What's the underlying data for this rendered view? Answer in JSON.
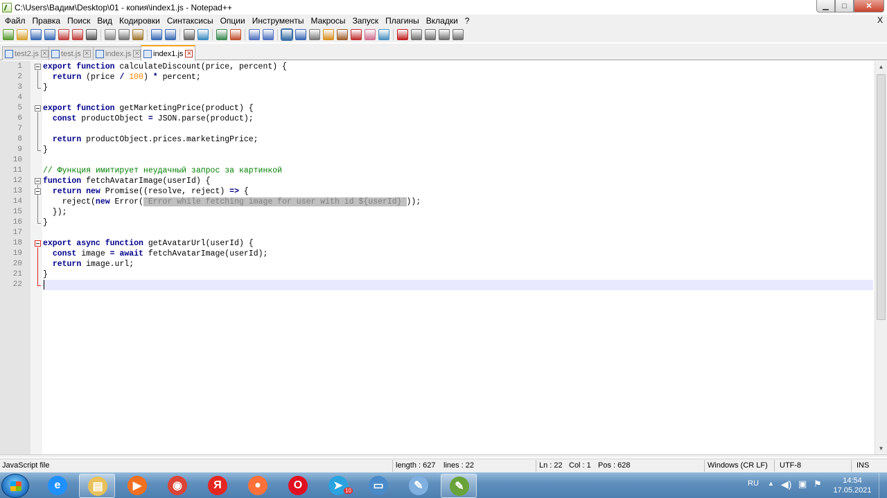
{
  "window": {
    "title": "C:\\Users\\Вадим\\Desktop\\01 - копия\\index1.js - Notepad++",
    "controls": {
      "minimize": "▁",
      "maximize": "□",
      "close": "✕"
    }
  },
  "menu": {
    "items": [
      "Файл",
      "Правка",
      "Поиск",
      "Вид",
      "Кодировки",
      "Синтаксисы",
      "Опции",
      "Инструменты",
      "Макросы",
      "Запуск",
      "Плагины",
      "Вкладки",
      "?"
    ],
    "close_label": "X"
  },
  "toolbar": {
    "icons": [
      "new-file-icon",
      "open-file-icon",
      "save-icon",
      "save-all-icon",
      "close-icon",
      "close-all-icon",
      "print-icon",
      "cut-icon",
      "copy-icon",
      "paste-icon",
      "undo-icon",
      "redo-icon",
      "find-icon",
      "replace-icon",
      "zoom-in-icon",
      "zoom-out-icon",
      "sync-vertical-icon",
      "sync-horizontal-icon",
      "word-wrap-icon",
      "all-chars-icon",
      "indent-guide-icon",
      "udl-icon",
      "doc-map-icon",
      "function-list-icon",
      "folder-workspace-icon",
      "monitoring-icon",
      "record-macro-icon",
      "stop-macro-icon",
      "play-macro-icon",
      "run-macro-multiple-icon",
      "save-macro-icon"
    ],
    "colors": {
      "accent": "#3a6ea5"
    }
  },
  "tabs": [
    {
      "label": "test2.js",
      "active": false
    },
    {
      "label": "test.js",
      "active": false
    },
    {
      "label": "index.js",
      "active": false
    },
    {
      "label": "index1.js",
      "active": true
    }
  ],
  "editor": {
    "line_numbers": [
      "1",
      "2",
      "3",
      "4",
      "5",
      "6",
      "7",
      "8",
      "9",
      "10",
      "11",
      "12",
      "13",
      "14",
      "15",
      "16",
      "17",
      "18",
      "19",
      "20",
      "21",
      "22"
    ],
    "lines": [
      [
        {
          "t": "export function ",
          "c": "kw"
        },
        {
          "t": "calculateDiscount(price, percent) {",
          "c": "fn"
        }
      ],
      [
        {
          "t": "  ",
          "c": "fn"
        },
        {
          "t": "return",
          "c": "kw"
        },
        {
          "t": " (price ",
          "c": "fn"
        },
        {
          "t": "/",
          "c": "op"
        },
        {
          "t": " ",
          "c": "fn"
        },
        {
          "t": "100",
          "c": "num"
        },
        {
          "t": ") ",
          "c": "fn"
        },
        {
          "t": "*",
          "c": "op"
        },
        {
          "t": " percent;",
          "c": "fn"
        }
      ],
      [
        {
          "t": "}",
          "c": "fn"
        }
      ],
      [],
      [
        {
          "t": "export function ",
          "c": "kw"
        },
        {
          "t": "getMarketingPrice(product) {",
          "c": "fn"
        }
      ],
      [
        {
          "t": "  ",
          "c": "fn"
        },
        {
          "t": "const",
          "c": "kw"
        },
        {
          "t": " productObject ",
          "c": "fn"
        },
        {
          "t": "=",
          "c": "op"
        },
        {
          "t": " JSON.parse(product);",
          "c": "fn"
        }
      ],
      [],
      [
        {
          "t": "  ",
          "c": "fn"
        },
        {
          "t": "return",
          "c": "kw"
        },
        {
          "t": " productObject.prices.marketingPrice;",
          "c": "fn"
        }
      ],
      [
        {
          "t": "}",
          "c": "fn"
        }
      ],
      [],
      [
        {
          "t": "// Функция имитирует неудачный запрос за картинкой",
          "c": "cm"
        }
      ],
      [
        {
          "t": "function ",
          "c": "kw"
        },
        {
          "t": "fetchAvatarImage(userId) {",
          "c": "fn"
        }
      ],
      [
        {
          "t": "  ",
          "c": "fn"
        },
        {
          "t": "return new",
          "c": "kw"
        },
        {
          "t": " Promise((resolve, reject) ",
          "c": "fn"
        },
        {
          "t": "=>",
          "c": "op"
        },
        {
          "t": " {",
          "c": "fn"
        }
      ],
      [
        {
          "t": "    reject(",
          "c": "fn"
        },
        {
          "t": "new",
          "c": "kw"
        },
        {
          "t": " Error(",
          "c": "fn"
        },
        {
          "t": "`Error while fetching image for user with id ${userId}`",
          "c": "str"
        },
        {
          "t": "));",
          "c": "fn"
        }
      ],
      [
        {
          "t": "  });",
          "c": "fn"
        }
      ],
      [
        {
          "t": "}",
          "c": "fn"
        }
      ],
      [],
      [
        {
          "t": "export async function ",
          "c": "kw"
        },
        {
          "t": "getAvatarUrl(userId) {",
          "c": "fn"
        }
      ],
      [
        {
          "t": "  ",
          "c": "fn"
        },
        {
          "t": "const",
          "c": "kw"
        },
        {
          "t": " image ",
          "c": "fn"
        },
        {
          "t": "=",
          "c": "op"
        },
        {
          "t": " ",
          "c": "fn"
        },
        {
          "t": "await",
          "c": "kw"
        },
        {
          "t": " fetchAvatarImage(userId);",
          "c": "fn"
        }
      ],
      [
        {
          "t": "  ",
          "c": "fn"
        },
        {
          "t": "return",
          "c": "kw"
        },
        {
          "t": " image.url;",
          "c": "fn"
        }
      ],
      [
        {
          "t": "}",
          "c": "fn"
        }
      ],
      []
    ],
    "current_line": 22
  },
  "statusbar": {
    "language": "JavaScript file",
    "length": "length : 627",
    "lines": "lines : 22",
    "ln": "Ln : 22",
    "col": "Col : 1",
    "pos": "Pos : 628",
    "eol": "Windows (CR LF)",
    "encoding": "UTF-8",
    "mode": "INS"
  },
  "taskbar": {
    "apps": [
      {
        "name": "internet-explorer-icon",
        "active": false,
        "color": "#1e90ff",
        "glyph": "e"
      },
      {
        "name": "file-explorer-icon",
        "active": true,
        "color": "#e8c15a",
        "glyph": "▤"
      },
      {
        "name": "media-player-icon",
        "active": false,
        "color": "#f07020",
        "glyph": "▶"
      },
      {
        "name": "chrome-icon",
        "active": false,
        "color": "#db4437",
        "glyph": "◉"
      },
      {
        "name": "yandex-browser-icon",
        "active": false,
        "color": "#e52620",
        "glyph": "Я"
      },
      {
        "name": "firefox-icon",
        "active": false,
        "color": "#ff7139",
        "glyph": "●"
      },
      {
        "name": "opera-icon",
        "active": false,
        "color": "#e01020",
        "glyph": "O"
      },
      {
        "name": "telegram-icon",
        "active": false,
        "color": "#2aa3df",
        "glyph": "➤",
        "badge": "10"
      },
      {
        "name": "remote-desktop-icon",
        "active": false,
        "color": "#4a8ac8",
        "glyph": "▭"
      },
      {
        "name": "paint-icon",
        "active": false,
        "color": "#7fb0e0",
        "glyph": "✎"
      },
      {
        "name": "notepad-plus-plus-icon",
        "active": true,
        "color": "#6aa33a",
        "glyph": "✎"
      }
    ],
    "tray": {
      "language": "RU",
      "time": "14:54",
      "date": "17.05.2021"
    }
  }
}
